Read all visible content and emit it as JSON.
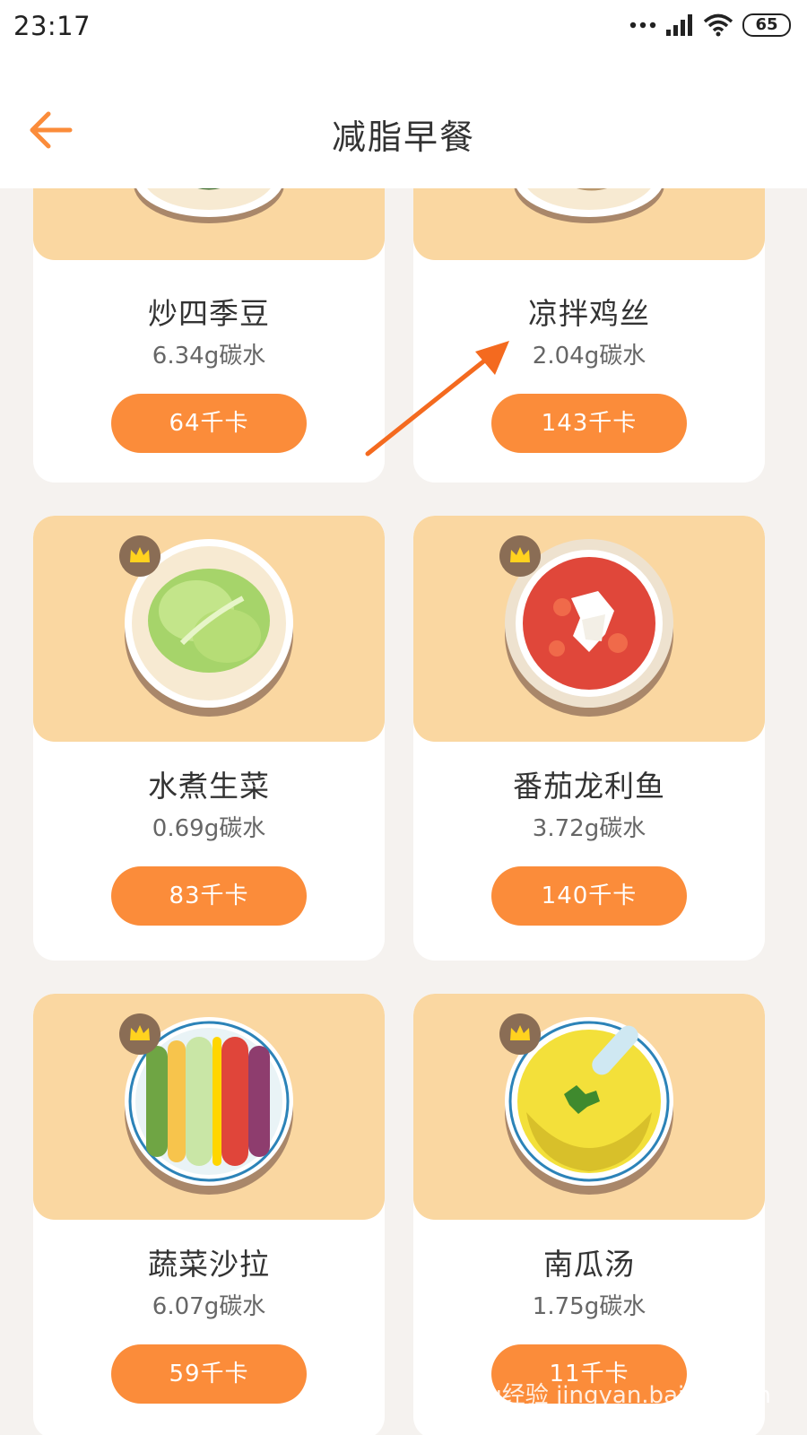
{
  "status_bar": {
    "time": "23:17",
    "battery": "65"
  },
  "header": {
    "title": "减脂早餐"
  },
  "cards": [
    {
      "name": "炒四季豆",
      "carb": "6.34g碳水",
      "calories": "64千卡",
      "vip": false
    },
    {
      "name": "凉拌鸡丝",
      "carb": "2.04g碳水",
      "calories": "143千卡",
      "vip": false
    },
    {
      "name": "水煮生菜",
      "carb": "0.69g碳水",
      "calories": "83千卡",
      "vip": true
    },
    {
      "name": "番茄龙利鱼",
      "carb": "3.72g碳水",
      "calories": "140千卡",
      "vip": true
    },
    {
      "name": "蔬菜沙拉",
      "carb": "6.07g碳水",
      "calories": "59千卡",
      "vip": true
    },
    {
      "name": "南瓜汤",
      "carb": "1.75g碳水",
      "calories": "11千卡",
      "vip": true
    }
  ],
  "watermark": "Baidu经验 jingyan.baidu.com",
  "colors": {
    "accent": "#fb8c3a",
    "card_image_bg": "#fad7a1",
    "page_bg": "#f5f2ef"
  }
}
